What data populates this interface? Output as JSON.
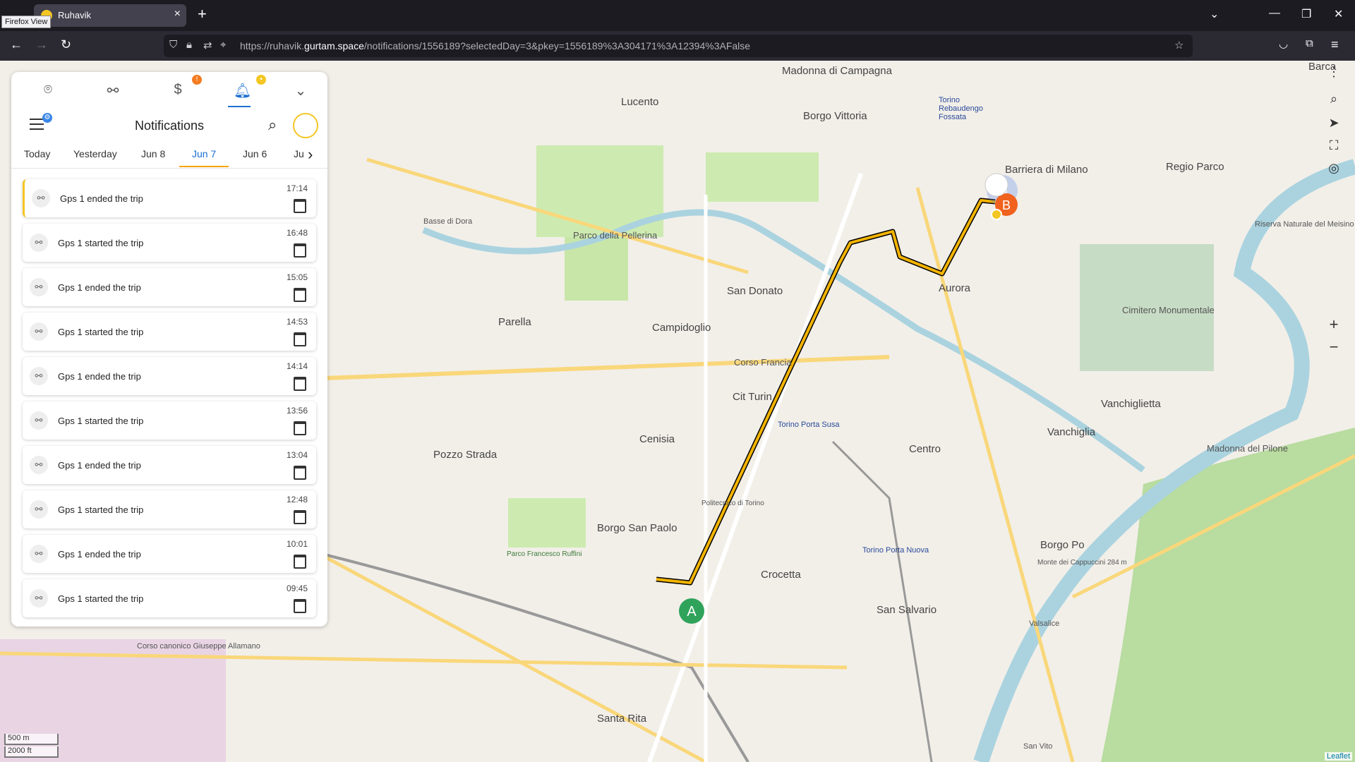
{
  "browser": {
    "tab_title": "Ruhavik",
    "tooltip": "Firefox View",
    "url_prefix": "https://ruhavik.",
    "url_domain": "gurtam.space",
    "url_path": "/notifications/1556189?selectedDay=3&pkey=1556189%3A304171%3A12394%3AFalse"
  },
  "panel": {
    "title": "Notifications",
    "badges": {
      "money": "!",
      "bell": "•"
    },
    "days": [
      "Today",
      "Yesterday",
      "Jun 8",
      "Jun 7",
      "Jun 6",
      "Ju"
    ],
    "selected_day": "Jun 7",
    "notifications": [
      {
        "text": "Gps 1 ended the trip",
        "time": "17:14"
      },
      {
        "text": "Gps 1 started the trip",
        "time": "16:48"
      },
      {
        "text": "Gps 1 ended the trip",
        "time": "15:05"
      },
      {
        "text": "Gps 1 started the trip",
        "time": "14:53"
      },
      {
        "text": "Gps 1 ended the trip",
        "time": "14:14"
      },
      {
        "text": "Gps 1 started the trip",
        "time": "13:56"
      },
      {
        "text": "Gps 1 ended the trip",
        "time": "13:04"
      },
      {
        "text": "Gps 1 started the trip",
        "time": "12:48"
      },
      {
        "text": "Gps 1 ended the trip",
        "time": "10:01"
      },
      {
        "text": "Gps 1 started the trip",
        "time": "09:45"
      }
    ]
  },
  "map": {
    "labels": {
      "l1": "Madonna di Campagna",
      "l2": "Lucento",
      "l3": "Borgo Vittoria",
      "l4": "Torino Rebaudengo Fossata",
      "l5": "Barriera di Milano",
      "l6": "Regio Parco",
      "l7": "Parco della Pellerina",
      "l8": "San Donato",
      "l9": "Aurora",
      "l10": "Parella",
      "l11": "Campidoglio",
      "l12": "Cit Turin",
      "l13": "Cenisia",
      "l14": "Pozzo Strada",
      "l15": "Centro",
      "l16": "Vanchiglia",
      "l17": "Vanchiglietta",
      "l18": "Borgo San Paolo",
      "l19": "Crocetta",
      "l20": "San Salvario",
      "l21": "Borgo Po",
      "l22": "Santa Rita",
      "l23": "Madonna del Pilone",
      "l24": "Cimitero Monumentale",
      "l25": "Torino Porta Susa",
      "l26": "Torino Porta Nuova",
      "l27": "Corso Francia",
      "l28": "Barca",
      "l29": "Basse di Dora",
      "l30": "Politecnico di Torino",
      "l31": "Parco Francesco Ruffini",
      "l32": "Riserva Naturale del Meisino",
      "l33": "Corso canonico Giuseppe Allamano",
      "l34": "San Vito",
      "l35": "Valsalice",
      "l36": "Monte dei Cappuccini 284 m"
    },
    "marker_a": "A",
    "marker_b": "B",
    "scale_m": "500 m",
    "scale_ft": "2000 ft",
    "attribution": "Leaflet",
    "route_color": "#f3b400"
  }
}
